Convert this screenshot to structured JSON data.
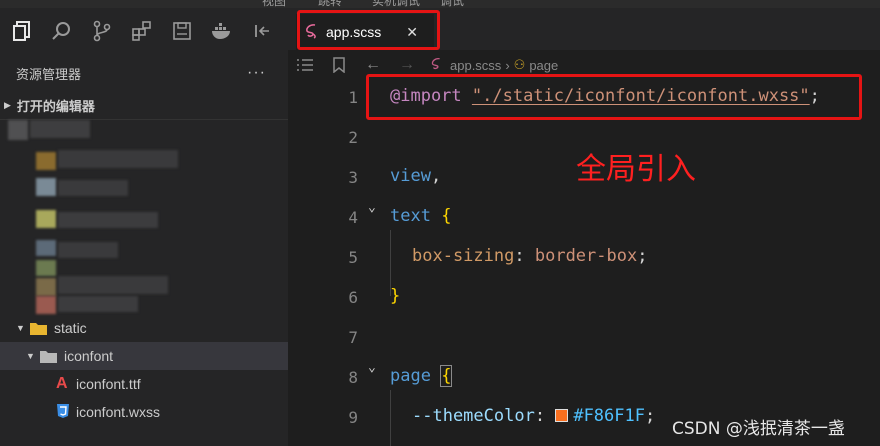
{
  "titlebar": {
    "fragments": [
      "视图",
      "跳转",
      "实机调试",
      "调试"
    ]
  },
  "sidebar": {
    "title": "资源管理器",
    "more": "···",
    "open_editors": "打开的编辑器",
    "tree": [
      {
        "label": "static",
        "kind": "folder",
        "expanded": true
      },
      {
        "label": "iconfont",
        "kind": "folder",
        "expanded": true,
        "selected": true
      },
      {
        "label": "iconfont.ttf",
        "kind": "font-file"
      },
      {
        "label": "iconfont.wxss",
        "kind": "css-file"
      }
    ]
  },
  "tab": {
    "label": "app.scss",
    "close": "✕"
  },
  "breadcrumb": {
    "file": "app.scss",
    "sep": "›",
    "symbol": "page"
  },
  "code": {
    "line_numbers": [
      "1",
      "2",
      "3",
      "4",
      "5",
      "6",
      "7",
      "8",
      "9"
    ],
    "l1_kw": "@import",
    "l1_str": "\"./static/iconfont/iconfont.wxss\"",
    "l1_semi": ";",
    "l3_tag": "view",
    "l3_punc": ",",
    "l4_tag": "text",
    "l4_brace": "{",
    "l5_prop": "box-sizing",
    "l5_colon": ":",
    "l5_val": "border-box",
    "l5_semi": ";",
    "l6_brace": "}",
    "l8_tag": "page",
    "l8_brace": "{",
    "l9_var": "--themeColor",
    "l9_colon": ":",
    "l9_hex": "#F86F1F",
    "l9_semi": ";"
  },
  "annotation": "全局引入",
  "watermark": "CSDN @浅抿清茶一盏",
  "colors": {
    "highlight_box": "#e51414",
    "theme_swatch": "#F86F1F",
    "folder": "#e8b530"
  }
}
